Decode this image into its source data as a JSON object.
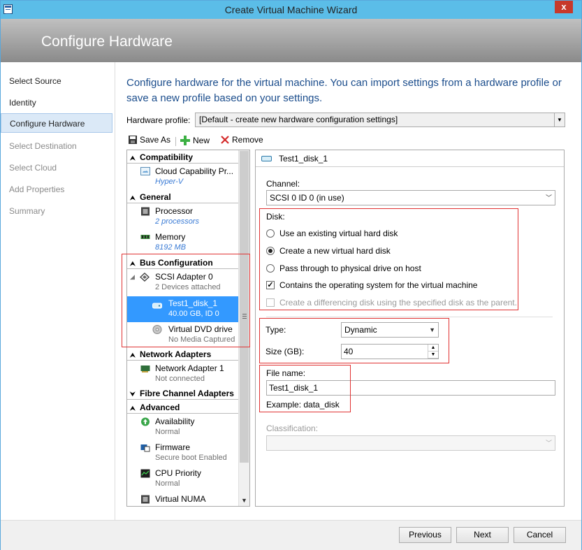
{
  "window": {
    "title": "Create Virtual Machine Wizard",
    "close_glyph": "x"
  },
  "header": {
    "title": "Configure Hardware"
  },
  "steps": [
    {
      "label": "Select Source",
      "state": "done"
    },
    {
      "label": "Identity",
      "state": "done"
    },
    {
      "label": "Configure Hardware",
      "state": "active"
    },
    {
      "label": "Select Destination",
      "state": "pending"
    },
    {
      "label": "Select Cloud",
      "state": "pending"
    },
    {
      "label": "Add Properties",
      "state": "pending"
    },
    {
      "label": "Summary",
      "state": "pending"
    }
  ],
  "intro": "Configure hardware for the virtual machine. You can import settings from a hardware profile or save a new profile based on your settings.",
  "hardware_profile": {
    "label": "Hardware profile:",
    "value": "[Default - create new hardware configuration settings]"
  },
  "toolbar": {
    "save_as": "Save As",
    "new": "New",
    "remove": "Remove"
  },
  "tree": {
    "compatibility": {
      "title": "Compatibility",
      "items": [
        {
          "name": "Cloud Capability Pr...",
          "sub": "Hyper-V"
        }
      ]
    },
    "general": {
      "title": "General",
      "items": [
        {
          "name": "Processor",
          "sub": "2 processors"
        },
        {
          "name": "Memory",
          "sub": "8192 MB"
        }
      ]
    },
    "bus": {
      "title": "Bus Configuration",
      "items": [
        {
          "name": "SCSI Adapter 0",
          "sub": "2 Devices attached"
        },
        {
          "name": "Test1_disk_1",
          "sub": "40.00 GB, ID 0"
        },
        {
          "name": "Virtual DVD drive",
          "sub": "No Media Captured"
        }
      ]
    },
    "network": {
      "title": "Network Adapters",
      "items": [
        {
          "name": "Network Adapter 1",
          "sub": "Not connected"
        }
      ]
    },
    "fibre": {
      "title": "Fibre Channel Adapters"
    },
    "advanced": {
      "title": "Advanced",
      "items": [
        {
          "name": "Availability",
          "sub": "Normal"
        },
        {
          "name": "Firmware",
          "sub": "Secure boot Enabled"
        },
        {
          "name": "CPU Priority",
          "sub": "Normal"
        },
        {
          "name": "Virtual NUMA",
          "sub": ""
        }
      ]
    }
  },
  "panel": {
    "title": "Test1_disk_1",
    "channel_label": "Channel:",
    "channel_value": "SCSI 0 ID 0 (in use)",
    "disk_label": "Disk:",
    "radio_existing": "Use an existing virtual hard disk",
    "radio_new": "Create a new virtual hard disk",
    "radio_pass": "Pass through to physical drive on host",
    "check_os": "Contains the operating system for the virtual machine",
    "check_diff": "Create a differencing disk using the specified disk as the parent.",
    "type_label": "Type:",
    "type_value": "Dynamic",
    "size_label": "Size (GB):",
    "size_value": "40",
    "file_label": "File name:",
    "file_value": "Test1_disk_1",
    "example": "Example: data_disk",
    "class_label": "Classification:",
    "class_value": ""
  },
  "buttons": {
    "previous": "Previous",
    "next": "Next",
    "cancel": "Cancel"
  },
  "colors": {
    "accent": "#3399ff",
    "titlebar": "#5bbde8",
    "highlight_box": "#e03131",
    "intro_text": "#1b4d8c"
  }
}
